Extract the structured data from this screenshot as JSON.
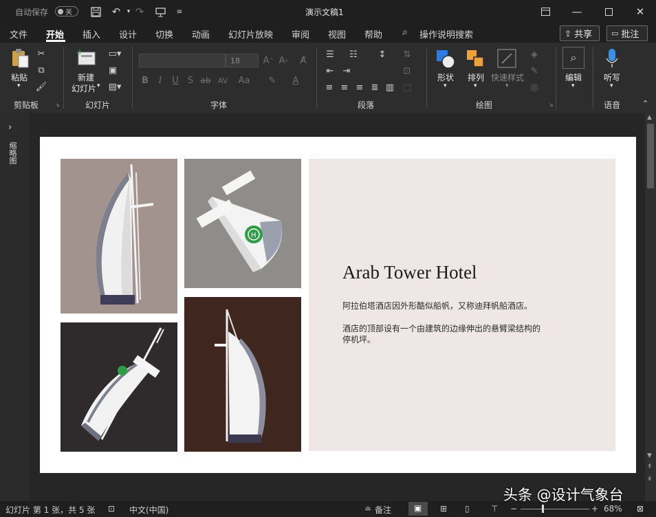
{
  "titlebar": {
    "autosave_label": "自动保存",
    "autosave_state": "关",
    "doc_title": "演示文稿1"
  },
  "menu": {
    "tabs": [
      "文件",
      "开始",
      "插入",
      "设计",
      "切换",
      "动画",
      "幻灯片放映",
      "审阅",
      "视图",
      "帮助"
    ],
    "active_tab": "开始",
    "search_label": "操作说明搜索",
    "share_label": "共享",
    "comment_label": "批注"
  },
  "ribbon": {
    "clipboard": {
      "paste_label": "粘贴",
      "group_label": "剪贴板"
    },
    "slides": {
      "new_slide_line1": "新建",
      "new_slide_line2": "幻灯片",
      "group_label": "幻灯片"
    },
    "font": {
      "font_size": "18",
      "group_label": "字体",
      "bold": "B",
      "italic": "I",
      "underline": "U",
      "shadow": "S",
      "strike": "ab",
      "spacing": "AV",
      "case": "Aa"
    },
    "paragraph": {
      "group_label": "段落"
    },
    "drawing": {
      "shapes_label": "形状",
      "arrange_label": "排列",
      "quick_styles_label": "快速样式",
      "group_label": "绘图"
    },
    "editing": {
      "label": "编辑"
    },
    "voice": {
      "dictate_label": "听写",
      "group_label": "语音"
    }
  },
  "thumbnail_pane": {
    "label": "缩略图"
  },
  "slide": {
    "title": "Arab Tower Hotel",
    "paragraph1": "阿拉伯塔酒店因外形酷似船帆，又称迪拜帆船酒店。",
    "paragraph2_line1": "酒店的顶部设有一个由建筑的边缘伸出的悬臂梁结构的",
    "paragraph2_line2": "停机坪。",
    "photos": [
      {
        "bg": "#a3938f"
      },
      {
        "bg": "#8e8d89"
      },
      {
        "bg": "#2f2b2c"
      },
      {
        "bg": "#3f2720"
      }
    ]
  },
  "statusbar": {
    "slide_info": "幻灯片 第 1 张，共 5 张",
    "language": "中文(中国)",
    "notes_label": "备注",
    "zoom": "68%",
    "watermark": "头条 @设计气象台"
  }
}
